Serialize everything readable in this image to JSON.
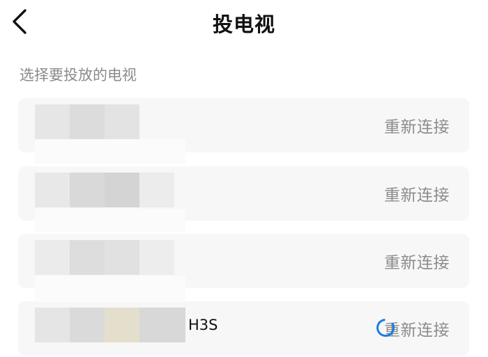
{
  "header": {
    "title": "投电视",
    "back_icon": "chevron-left-icon"
  },
  "section": {
    "label": "选择要投放的电视"
  },
  "devices": [
    {
      "name_suffix": "",
      "action_label": "重新连接",
      "connecting": false
    },
    {
      "name_suffix": "",
      "action_label": "重新连接",
      "connecting": false
    },
    {
      "name_suffix": "",
      "action_label": "重新连接",
      "connecting": false
    },
    {
      "name_suffix": "H3S",
      "action_label": "重新连接",
      "connecting": true
    }
  ],
  "colors": {
    "card_background": "#f7f7f7",
    "action_text": "#8c8c8c",
    "spinner": "#1a7de0"
  }
}
